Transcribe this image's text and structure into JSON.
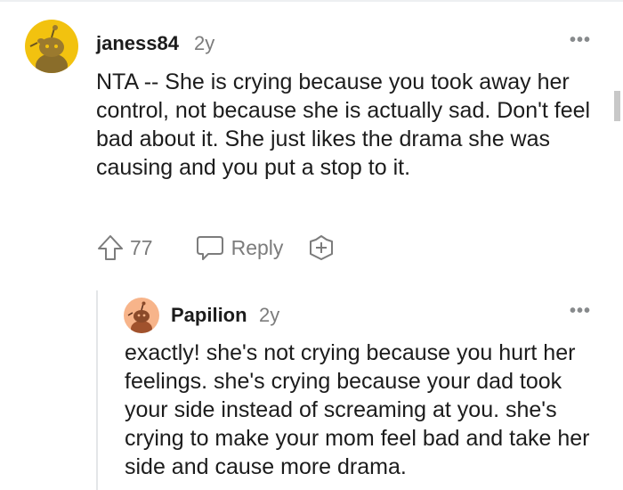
{
  "comments": [
    {
      "username": "janess84",
      "age": "2y",
      "avatar_icon": "snoo-avatar-icon",
      "avatar_bg": "#f2c20f",
      "more_icon": "more-options-icon",
      "text": "NTA -- She is crying because you took away her control, not because she is actually sad. Don't feel bad about it. She just likes the drama she was causing and you put a stop to it.",
      "vote_count": "77",
      "reply_label": "Reply"
    },
    {
      "username": "Papilion",
      "age": "2y",
      "avatar_icon": "snoo-avatar-icon",
      "avatar_bg": "#f7b48a",
      "more_icon": "more-options-icon",
      "text": "exactly! she's not crying because you hurt her feelings. she's crying because your dad took your side instead of screaming at you. she's crying to make your mom feel bad and take her side and cause more drama."
    }
  ]
}
